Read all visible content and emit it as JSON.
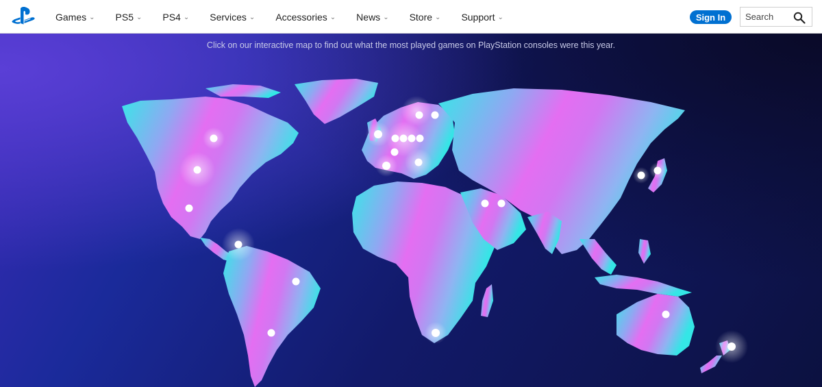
{
  "nav": {
    "brand_icon": "playstation-logo",
    "menu": [
      {
        "label": "Games"
      },
      {
        "label": "PS5"
      },
      {
        "label": "PS4"
      },
      {
        "label": "Services"
      },
      {
        "label": "Accessories"
      },
      {
        "label": "News"
      },
      {
        "label": "Store"
      },
      {
        "label": "Support"
      }
    ],
    "sign_in_label": "Sign In",
    "search_placeholder": "Search"
  },
  "hero": {
    "intro_text": "Click on our interactive map to find out what the most played games on PlayStation consoles were this year."
  },
  "colors": {
    "accent": "#0070d1",
    "map_cyan": "#34e0e6",
    "map_magenta": "#e66ef0",
    "background_navy": "#0c1140"
  }
}
